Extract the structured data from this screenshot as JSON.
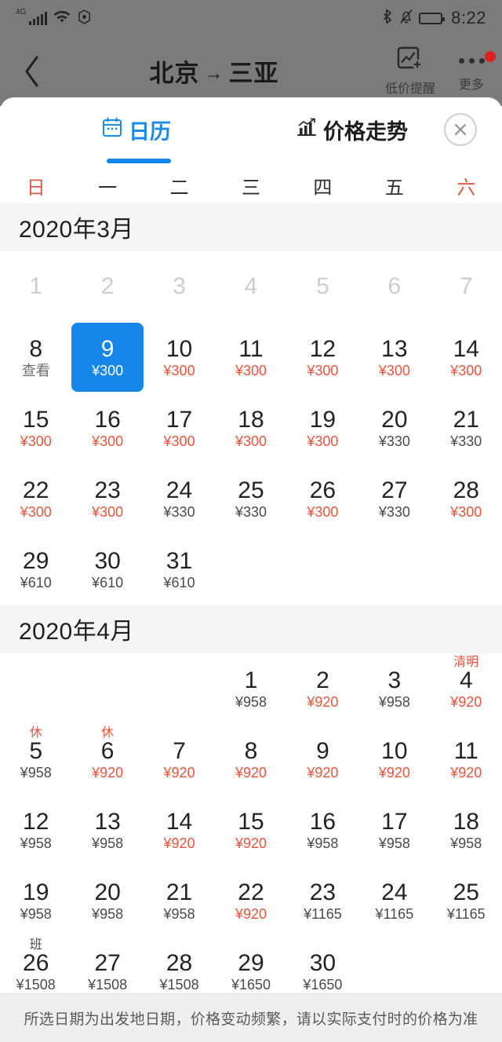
{
  "statusbar": {
    "network": "4G",
    "time": "8:22",
    "icons": [
      "signal-bars-icon",
      "wifi-icon",
      "hexagon-icon",
      "bluetooth-icon",
      "bell-muted-icon",
      "battery-icon"
    ],
    "battery_level": 40
  },
  "navbar": {
    "back_label": "‹",
    "origin": "北京",
    "arrow": "→",
    "destination": "三亚",
    "price_alert_label": "低价提醒",
    "more_label": "更多",
    "has_notification_dot": true
  },
  "tabs": [
    {
      "id": "calendar",
      "label": "日历",
      "icon": "calendar-icon",
      "active": true
    },
    {
      "id": "price_trend",
      "label": "价格走势",
      "icon": "chart-bars-icon",
      "active": false
    }
  ],
  "close_label": "✕",
  "weekdays": [
    {
      "label": "日",
      "weekend": true
    },
    {
      "label": "一",
      "weekend": false
    },
    {
      "label": "二",
      "weekend": false
    },
    {
      "label": "三",
      "weekend": false
    },
    {
      "label": "四",
      "weekend": false
    },
    {
      "label": "五",
      "weekend": false
    },
    {
      "label": "六",
      "weekend": true
    }
  ],
  "colors": {
    "selected_bg": "#1587e8",
    "accent_blue": "#1e8ae8",
    "low_price_red": "#e8543c",
    "normal_price": "#4a4a4a",
    "past_day": "#cdcdcd",
    "month_header_bg": "#f4f5f6",
    "footer_bg": "#eeeff0"
  },
  "months": [
    {
      "title": "2020年3月",
      "lead_blanks": 0,
      "days": [
        {
          "day": "1",
          "past": true
        },
        {
          "day": "2",
          "past": true
        },
        {
          "day": "3",
          "past": true
        },
        {
          "day": "4",
          "past": true
        },
        {
          "day": "5",
          "past": true
        },
        {
          "day": "6",
          "past": true
        },
        {
          "day": "7",
          "past": true
        },
        {
          "day": "8",
          "sub": "查看"
        },
        {
          "day": "9",
          "price": "¥300",
          "selected": true
        },
        {
          "day": "10",
          "price": "¥300",
          "low": true
        },
        {
          "day": "11",
          "price": "¥300",
          "low": true
        },
        {
          "day": "12",
          "price": "¥300",
          "low": true
        },
        {
          "day": "13",
          "price": "¥300",
          "low": true
        },
        {
          "day": "14",
          "price": "¥300",
          "low": true
        },
        {
          "day": "15",
          "price": "¥300",
          "low": true
        },
        {
          "day": "16",
          "price": "¥300",
          "low": true
        },
        {
          "day": "17",
          "price": "¥300",
          "low": true
        },
        {
          "day": "18",
          "price": "¥300",
          "low": true
        },
        {
          "day": "19",
          "price": "¥300",
          "low": true
        },
        {
          "day": "20",
          "price": "¥330"
        },
        {
          "day": "21",
          "price": "¥330"
        },
        {
          "day": "22",
          "price": "¥300",
          "low": true
        },
        {
          "day": "23",
          "price": "¥300",
          "low": true
        },
        {
          "day": "24",
          "price": "¥330"
        },
        {
          "day": "25",
          "price": "¥330"
        },
        {
          "day": "26",
          "price": "¥300",
          "low": true
        },
        {
          "day": "27",
          "price": "¥330"
        },
        {
          "day": "28",
          "price": "¥300",
          "low": true
        },
        {
          "day": "29",
          "price": "¥610"
        },
        {
          "day": "30",
          "price": "¥610"
        },
        {
          "day": "31",
          "price": "¥610"
        }
      ]
    },
    {
      "title": "2020年4月",
      "lead_blanks": 3,
      "days": [
        {
          "day": "1",
          "price": "¥958"
        },
        {
          "day": "2",
          "price": "¥920",
          "low": true
        },
        {
          "day": "3",
          "price": "¥958"
        },
        {
          "day": "4",
          "price": "¥920",
          "low": true,
          "badge": "清明"
        },
        {
          "day": "5",
          "price": "¥958",
          "badge": "休"
        },
        {
          "day": "6",
          "price": "¥920",
          "low": true,
          "badge": "休"
        },
        {
          "day": "7",
          "price": "¥920",
          "low": true
        },
        {
          "day": "8",
          "price": "¥920",
          "low": true
        },
        {
          "day": "9",
          "price": "¥920",
          "low": true
        },
        {
          "day": "10",
          "price": "¥920",
          "low": true
        },
        {
          "day": "11",
          "price": "¥920",
          "low": true
        },
        {
          "day": "12",
          "price": "¥958"
        },
        {
          "day": "13",
          "price": "¥958"
        },
        {
          "day": "14",
          "price": "¥920",
          "low": true
        },
        {
          "day": "15",
          "price": "¥920",
          "low": true
        },
        {
          "day": "16",
          "price": "¥958"
        },
        {
          "day": "17",
          "price": "¥958"
        },
        {
          "day": "18",
          "price": "¥958"
        },
        {
          "day": "19",
          "price": "¥958"
        },
        {
          "day": "20",
          "price": "¥958"
        },
        {
          "day": "21",
          "price": "¥958"
        },
        {
          "day": "22",
          "price": "¥920",
          "low": true
        },
        {
          "day": "23",
          "price": "¥1165"
        },
        {
          "day": "24",
          "price": "¥1165"
        },
        {
          "day": "25",
          "price": "¥1165"
        },
        {
          "day": "26",
          "price": "¥1508",
          "badge": "班",
          "badge_dark": true
        },
        {
          "day": "27",
          "price": "¥1508"
        },
        {
          "day": "28",
          "price": "¥1508"
        },
        {
          "day": "29",
          "price": "¥1650"
        },
        {
          "day": "30",
          "price": "¥1650"
        }
      ]
    }
  ],
  "footer_note": "所选日期为出发地日期，价格变动频繁，请以实际支付时的价格为准"
}
